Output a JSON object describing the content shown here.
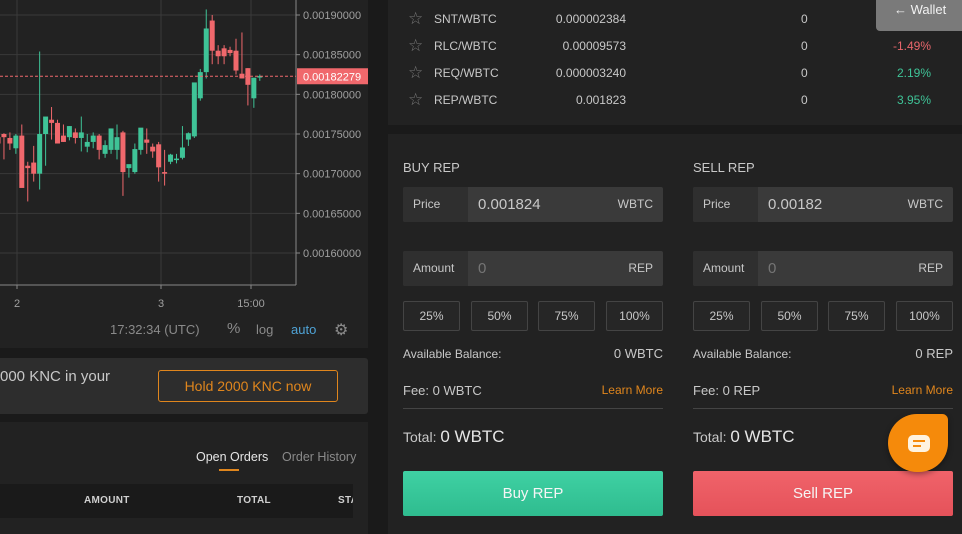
{
  "chart": {
    "time_readout": "17:32:34 (UTC)",
    "percent_label": "%",
    "log_label": "log",
    "auto_label": "auto",
    "current_price_label": "0.00182279",
    "colors": {
      "up": "#3fc397",
      "down": "#f0686c",
      "grid": "#3a3a3a",
      "axis": "#888888",
      "price_line": "#f0686c"
    }
  },
  "chart_data": {
    "type": "candlestick",
    "title": "",
    "xlabel": "",
    "ylabel": "",
    "ylim": [
      0.00156,
      0.00192
    ],
    "y_ticks": [
      "0.00190000",
      "0.00185000",
      "0.00180000",
      "0.00175000",
      "0.00170000",
      "0.00165000",
      "0.00160000"
    ],
    "y_tick_values": [
      0.0019,
      0.00185,
      0.0018,
      0.00175,
      0.0017,
      0.00165,
      0.0016
    ],
    "x_ticks": [
      "2",
      "3",
      "15:00"
    ],
    "x_tick_index": [
      3,
      27,
      42
    ],
    "current_price": 0.00182279,
    "grid": true,
    "candles": [
      {
        "o": 0.001746,
        "h": 0.001751,
        "l": 0.001721,
        "c": 0.001738
      },
      {
        "o": 0.00175,
        "h": 0.001751,
        "l": 0.001718,
        "c": 0.001746
      },
      {
        "o": 0.001745,
        "h": 0.001752,
        "l": 0.00173,
        "c": 0.001738
      },
      {
        "o": 0.001732,
        "h": 0.00175,
        "l": 0.001725,
        "c": 0.001748
      },
      {
        "o": 0.001748,
        "h": 0.001762,
        "l": 0.00169,
        "c": 0.001682
      },
      {
        "o": 0.00171,
        "h": 0.001715,
        "l": 0.001665,
        "c": 0.001707
      },
      {
        "o": 0.001714,
        "h": 0.001735,
        "l": 0.00169,
        "c": 0.0017
      },
      {
        "o": 0.0017,
        "h": 0.001854,
        "l": 0.00168,
        "c": 0.00175
      },
      {
        "o": 0.00175,
        "h": 0.00177,
        "l": 0.00171,
        "c": 0.001772
      },
      {
        "o": 0.001768,
        "h": 0.001784,
        "l": 0.001743,
        "c": 0.001764
      },
      {
        "o": 0.001764,
        "h": 0.001768,
        "l": 0.001738,
        "c": 0.001738
      },
      {
        "o": 0.001748,
        "h": 0.001762,
        "l": 0.00174,
        "c": 0.00174
      },
      {
        "o": 0.001746,
        "h": 0.00176,
        "l": 0.001742,
        "c": 0.00176
      },
      {
        "o": 0.001752,
        "h": 0.001757,
        "l": 0.001738,
        "c": 0.001745
      },
      {
        "o": 0.001745,
        "h": 0.001772,
        "l": 0.001728,
        "c": 0.001752
      },
      {
        "o": 0.001734,
        "h": 0.00175,
        "l": 0.001727,
        "c": 0.00174
      },
      {
        "o": 0.00174,
        "h": 0.001752,
        "l": 0.001732,
        "c": 0.001748
      },
      {
        "o": 0.001748,
        "h": 0.00175,
        "l": 0.001718,
        "c": 0.00173
      },
      {
        "o": 0.001725,
        "h": 0.001742,
        "l": 0.00172,
        "c": 0.001736
      },
      {
        "o": 0.00173,
        "h": 0.001757,
        "l": 0.001725,
        "c": 0.001757
      },
      {
        "o": 0.00173,
        "h": 0.001762,
        "l": 0.001718,
        "c": 0.001746
      },
      {
        "o": 0.001752,
        "h": 0.001754,
        "l": 0.001672,
        "c": 0.001702
      },
      {
        "o": 0.001707,
        "h": 0.00171,
        "l": 0.001695,
        "c": 0.001712
      },
      {
        "o": 0.001702,
        "h": 0.001738,
        "l": 0.0017,
        "c": 0.001731
      },
      {
        "o": 0.00173,
        "h": 0.001743,
        "l": 0.001724,
        "c": 0.001758
      },
      {
        "o": 0.001743,
        "h": 0.001757,
        "l": 0.001725,
        "c": 0.001739
      },
      {
        "o": 0.001734,
        "h": 0.001738,
        "l": 0.00172,
        "c": 0.001728
      },
      {
        "o": 0.001737,
        "h": 0.00174,
        "l": 0.00169,
        "c": 0.001708
      },
      {
        "o": 0.001702,
        "h": 0.00173,
        "l": 0.001685,
        "c": 0.0017
      },
      {
        "o": 0.001715,
        "h": 0.001725,
        "l": 0.001712,
        "c": 0.001724
      },
      {
        "o": 0.001718,
        "h": 0.001725,
        "l": 0.001713,
        "c": 0.001719
      },
      {
        "o": 0.00172,
        "h": 0.00176,
        "l": 0.001718,
        "c": 0.001733
      },
      {
        "o": 0.001743,
        "h": 0.001752,
        "l": 0.001735,
        "c": 0.001751
      },
      {
        "o": 0.001747,
        "h": 0.001792,
        "l": 0.001745,
        "c": 0.001815
      },
      {
        "o": 0.001795,
        "h": 0.001832,
        "l": 0.001792,
        "c": 0.001828
      },
      {
        "o": 0.001828,
        "h": 0.001907,
        "l": 0.00182,
        "c": 0.001883
      },
      {
        "o": 0.001893,
        "h": 0.0019,
        "l": 0.001838,
        "c": 0.001855
      },
      {
        "o": 0.001855,
        "h": 0.001862,
        "l": 0.001838,
        "c": 0.001848
      },
      {
        "o": 0.001858,
        "h": 0.001862,
        "l": 0.001838,
        "c": 0.001848
      },
      {
        "o": 0.001856,
        "h": 0.00186,
        "l": 0.001848,
        "c": 0.001852
      },
      {
        "o": 0.001855,
        "h": 0.00187,
        "l": 0.001825,
        "c": 0.00183
      },
      {
        "o": 0.001826,
        "h": 0.001878,
        "l": 0.00182,
        "c": 0.00182
      },
      {
        "o": 0.001833,
        "h": 0.001833,
        "l": 0.001786,
        "c": 0.001812
      },
      {
        "o": 0.001795,
        "h": 0.00182,
        "l": 0.001783,
        "c": 0.001821
      },
      {
        "o": 0.001822,
        "h": 0.001825,
        "l": 0.001817,
        "c": 0.001823
      }
    ]
  },
  "promo": {
    "text": "000 KNC in your",
    "button_label": "Hold 2000 KNC now"
  },
  "orders": {
    "tabs": [
      {
        "label": "Open Orders",
        "active": true
      },
      {
        "label": "Order History",
        "active": false
      }
    ],
    "columns": [
      "AMOUNT",
      "TOTAL",
      "STATUS"
    ]
  },
  "wallet_button": "← Wallet",
  "pairs": [
    {
      "name": "SNT/WBTC",
      "price": "0.000002384",
      "volume": "0",
      "change": "",
      "direction": ""
    },
    {
      "name": "RLC/WBTC",
      "price": "0.00009573",
      "volume": "0",
      "change": "-1.49%",
      "direction": "neg"
    },
    {
      "name": "REQ/WBTC",
      "price": "0.000003240",
      "volume": "0",
      "change": "2.19%",
      "direction": "pos"
    },
    {
      "name": "REP/WBTC",
      "price": "0.001823",
      "volume": "0",
      "change": "3.95%",
      "direction": "pos"
    }
  ],
  "buy": {
    "title": "BUY REP",
    "price_label": "Price",
    "price_value": "0.001824",
    "price_unit": "WBTC",
    "amount_label": "Amount",
    "amount_placeholder": "0",
    "amount_unit": "REP",
    "percents": [
      "25%",
      "50%",
      "75%",
      "100%"
    ],
    "balance_label": "Available Balance:",
    "balance_value": "0 WBTC",
    "fee_label": "Fee: 0 WBTC",
    "learn_more": "Learn More",
    "total_label": "Total:",
    "total_value": "0 WBTC",
    "button_label": "Buy REP"
  },
  "sell": {
    "title": "SELL REP",
    "price_label": "Price",
    "price_value": "0.00182",
    "price_unit": "WBTC",
    "amount_label": "Amount",
    "amount_placeholder": "0",
    "amount_unit": "REP",
    "percents": [
      "25%",
      "50%",
      "75%",
      "100%"
    ],
    "balance_label": "Available Balance:",
    "balance_value": "0 REP",
    "fee_label": "Fee: 0 REP",
    "learn_more": "Learn More",
    "total_label": "Total:",
    "total_value": "0 WBTC",
    "button_label": "Sell REP"
  }
}
